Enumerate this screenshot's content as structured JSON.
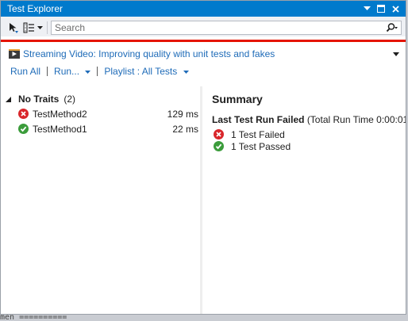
{
  "window": {
    "title": "Test Explorer"
  },
  "search": {
    "placeholder": "Search"
  },
  "banner": {
    "text": "Streaming Video: Improving quality with unit tests and fakes"
  },
  "actions": {
    "run_all": "Run All",
    "run": "Run...",
    "playlist": "Playlist : All Tests"
  },
  "tests": {
    "group": {
      "name": "No Traits",
      "count": "(2)"
    },
    "items": [
      {
        "name": "TestMethod2",
        "duration": "129 ms",
        "status": "failed"
      },
      {
        "name": "TestMethod1",
        "duration": "22 ms",
        "status": "passed"
      }
    ]
  },
  "summary": {
    "title": "Summary",
    "last_run_label": "Last Test Run Failed",
    "last_run_detail": "(Total Run Time 0:00:01",
    "failed": "1 Test Failed",
    "passed": "1 Test Passed"
  },
  "background": {
    "fragment": "men =========="
  },
  "colors": {
    "title_bar": "#007acc",
    "error_bar": "#e51400",
    "link": "#1e6bb8",
    "failed": "#d9262b",
    "passed": "#3b9c3b"
  }
}
